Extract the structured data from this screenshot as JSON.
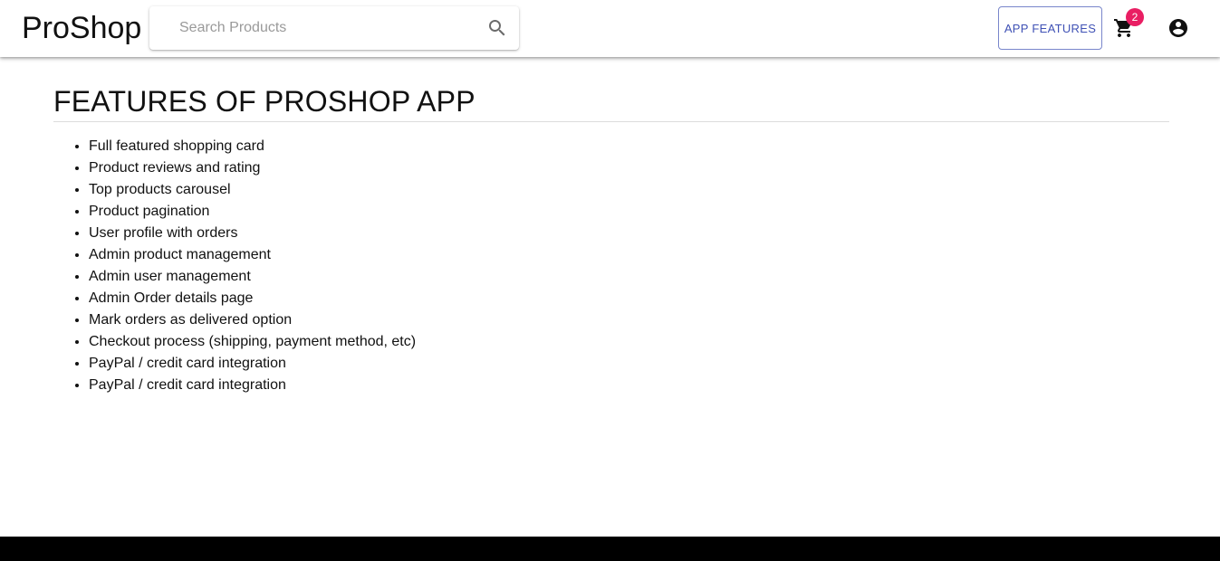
{
  "header": {
    "brand": "ProShop",
    "search_placeholder": "Search Products",
    "app_features_label": "APP FEATURES",
    "cart_count": "2",
    "icons": {
      "search": "search-icon",
      "cart": "shopping-cart-icon",
      "account": "account-circle-icon"
    },
    "colors": {
      "accent": "#3f51b5",
      "badge": "#e91e63"
    }
  },
  "main": {
    "title": "FEATURES OF PROSHOP APP",
    "features": [
      "Full featured shopping card",
      "Product reviews and rating",
      "Top products carousel",
      "Product pagination",
      "User profile with orders",
      "Admin product management",
      "Admin user management",
      "Admin Order details page",
      "Mark orders as delivered option",
      "Checkout process (shipping, payment method, etc)",
      "PayPal / credit card integration",
      "PayPal / credit card integration"
    ]
  },
  "footer": {
    "color": "#000000"
  }
}
